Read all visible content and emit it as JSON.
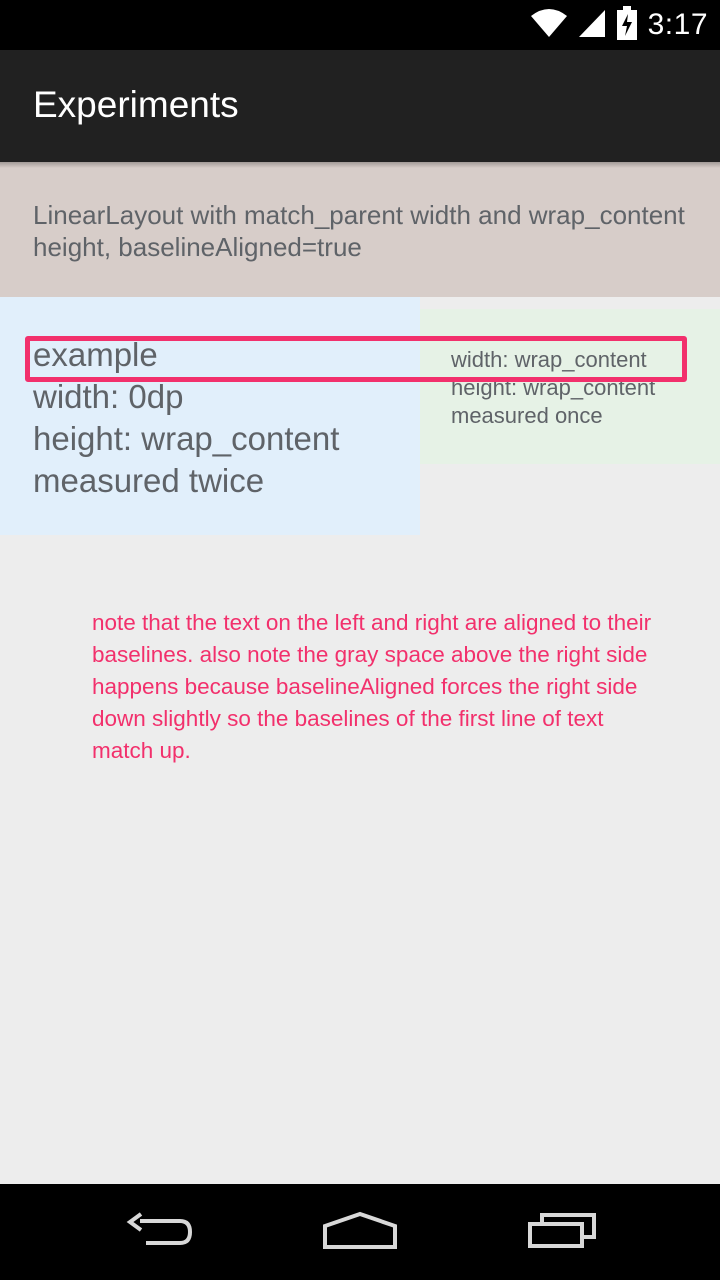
{
  "status_bar": {
    "time": "3:17",
    "icons": [
      "wifi-icon",
      "signal-icon",
      "battery-charging-icon"
    ]
  },
  "action_bar": {
    "title": "Experiments"
  },
  "description": {
    "text": "LinearLayout with match_parent width and wrap_content height, baselineAligned=true"
  },
  "left_column": {
    "lines": [
      "example",
      "width: 0dp",
      "height: wrap_content",
      "measured twice"
    ]
  },
  "right_column": {
    "lines": [
      "width: wrap_content",
      "height: wrap_content",
      "measured once"
    ]
  },
  "note": {
    "text": "note that the text on the left and right are aligned to their baselines. also note the gray space above the right side happens because baselineAligned forces the right side down slightly so the baselines of the first line of text match up."
  },
  "nav_bar": {
    "buttons": [
      "back-icon",
      "home-icon",
      "recent-apps-icon"
    ]
  },
  "colors": {
    "highlight": "#f2306c",
    "action_bar": "#212121",
    "desc_panel": "#d7cdc9",
    "left_column": "#e1effb",
    "right_column": "#e6f2e6",
    "background": "#ededed"
  }
}
